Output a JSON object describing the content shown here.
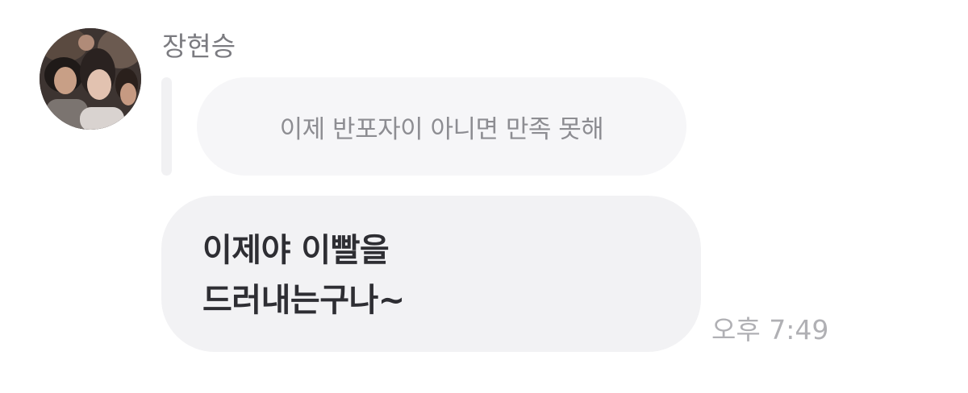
{
  "message": {
    "sender_name": "장현승",
    "avatar_icon": "profile-photo",
    "reply_quote": "이제 반포자이 아니면 만족 못해",
    "text_lines": [
      "이제야 이빨을",
      "드러내는구나~"
    ],
    "timestamp": "오후 7:49"
  },
  "colors": {
    "sender_name": "#7b7b80",
    "reply_bubble_bg": "#f6f6f8",
    "reply_text": "#8d8d92",
    "message_bubble_bg": "#f2f2f4",
    "message_text": "#2e2e33",
    "timestamp": "#b0b0b4"
  }
}
